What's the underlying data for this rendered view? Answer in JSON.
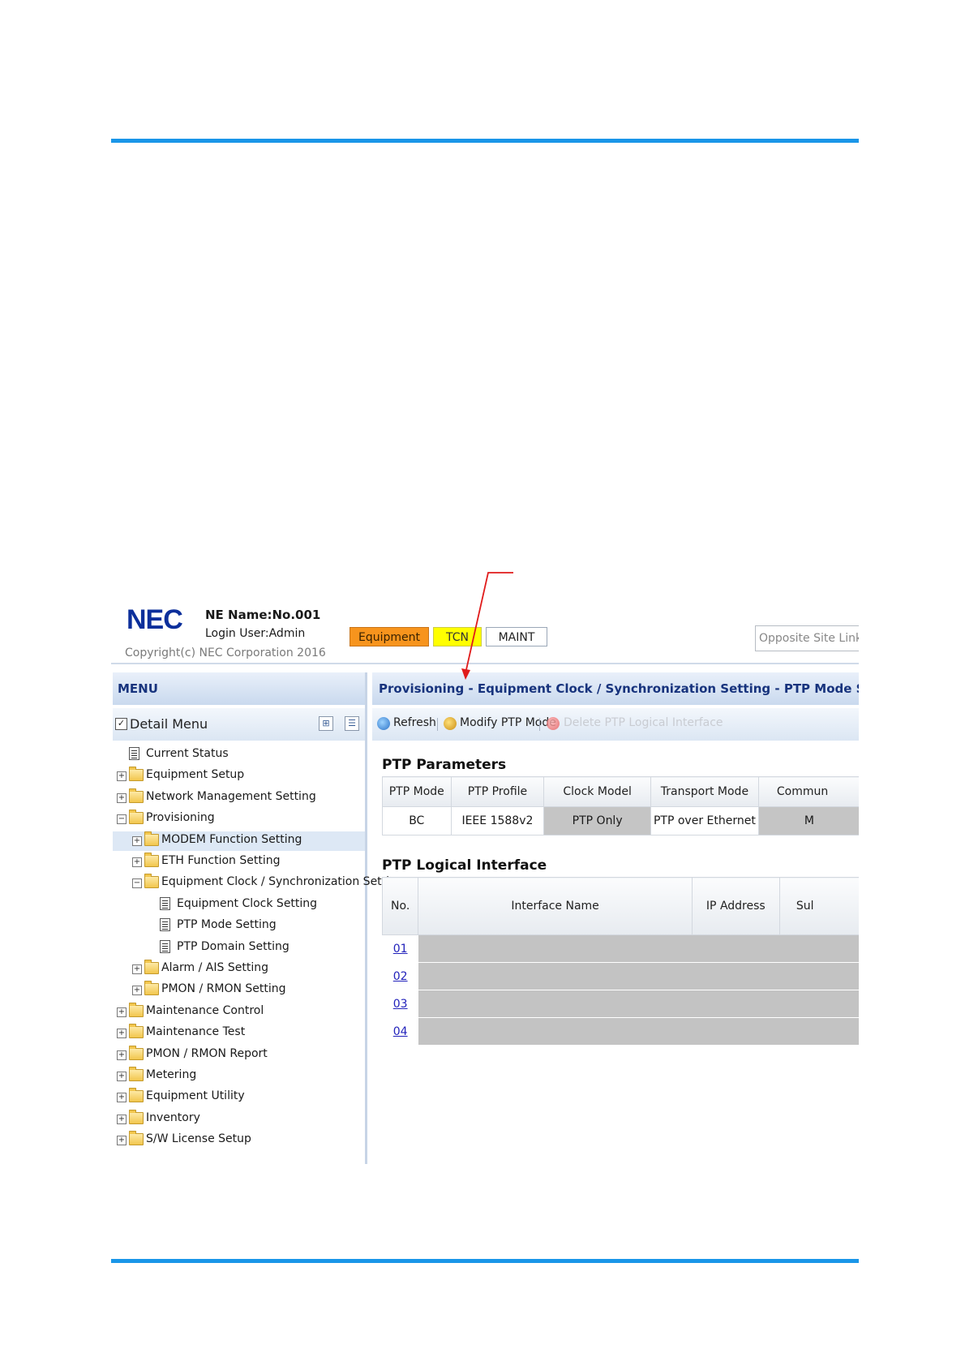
{
  "header": {
    "logo": "NEC",
    "ne_name": "NE Name:No.001",
    "login_user": "Login User:Admin",
    "copyright": "Copyright(c) NEC Corporation 2016",
    "tabs": [
      {
        "label": "Equipment",
        "color": "#f7941d"
      },
      {
        "label": "TCN",
        "color": "#ffff00"
      },
      {
        "label": "MAINT",
        "color": "#ffffff"
      }
    ],
    "opposite_site_links": "Opposite Site Links"
  },
  "menu": {
    "title": "MENU",
    "detail_menu_label": "Detail Menu",
    "detail_menu_checked": true,
    "tree": [
      {
        "label": "Current Status",
        "depth": 0,
        "type": "page",
        "toggle": ""
      },
      {
        "label": "Equipment Setup",
        "depth": 0,
        "type": "folder",
        "toggle": "+"
      },
      {
        "label": "Network Management Setting",
        "depth": 0,
        "type": "folder",
        "toggle": "+"
      },
      {
        "label": "Provisioning",
        "depth": 0,
        "type": "folder",
        "toggle": "-"
      },
      {
        "label": "MODEM Function Setting",
        "depth": 1,
        "type": "folder",
        "toggle": "+",
        "selected": true
      },
      {
        "label": "ETH Function Setting",
        "depth": 1,
        "type": "folder",
        "toggle": "+"
      },
      {
        "label": "Equipment Clock / Synchronization Setting",
        "depth": 1,
        "type": "folder",
        "toggle": "-"
      },
      {
        "label": "Equipment Clock Setting",
        "depth": 2,
        "type": "page",
        "toggle": ""
      },
      {
        "label": "PTP Mode Setting",
        "depth": 2,
        "type": "page",
        "toggle": ""
      },
      {
        "label": "PTP Domain Setting",
        "depth": 2,
        "type": "page",
        "toggle": ""
      },
      {
        "label": "Alarm / AIS Setting",
        "depth": 1,
        "type": "folder",
        "toggle": "+"
      },
      {
        "label": "PMON / RMON Setting",
        "depth": 1,
        "type": "folder",
        "toggle": "+"
      },
      {
        "label": "Maintenance Control",
        "depth": 0,
        "type": "folder",
        "toggle": "+"
      },
      {
        "label": "Maintenance Test",
        "depth": 0,
        "type": "folder",
        "toggle": "+"
      },
      {
        "label": "PMON / RMON Report",
        "depth": 0,
        "type": "folder",
        "toggle": "+"
      },
      {
        "label": "Metering",
        "depth": 0,
        "type": "folder",
        "toggle": "+"
      },
      {
        "label": "Equipment Utility",
        "depth": 0,
        "type": "folder",
        "toggle": "+"
      },
      {
        "label": "Inventory",
        "depth": 0,
        "type": "folder",
        "toggle": "+"
      },
      {
        "label": "S/W License Setup",
        "depth": 0,
        "type": "folder",
        "toggle": "+"
      }
    ]
  },
  "content": {
    "page_title": "Provisioning - Equipment Clock / Synchronization Setting - PTP Mode Setting",
    "toolbar": {
      "refresh": "Refresh",
      "modify_ptp_mode": "Modify PTP Mode",
      "delete_ptp_logical_interface": "Delete PTP Logical Interface"
    },
    "ptp_parameters": {
      "title": "PTP Parameters",
      "headers": [
        "PTP Mode",
        "PTP Profile",
        "Clock Model",
        "Transport Mode",
        "Commun"
      ],
      "row": [
        "BC",
        "IEEE 1588v2",
        "PTP Only",
        "PTP over Ethernet",
        "M"
      ]
    },
    "ptp_logical_interface": {
      "title": "PTP Logical Interface",
      "headers": [
        "No.",
        "Interface Name",
        "IP Address",
        "Sul"
      ],
      "rows": [
        "01",
        "02",
        "03",
        "04"
      ]
    }
  },
  "colors": {
    "rule": "#1a96e8",
    "panel_title": "#17337d",
    "annotation": "#e01b1b"
  }
}
